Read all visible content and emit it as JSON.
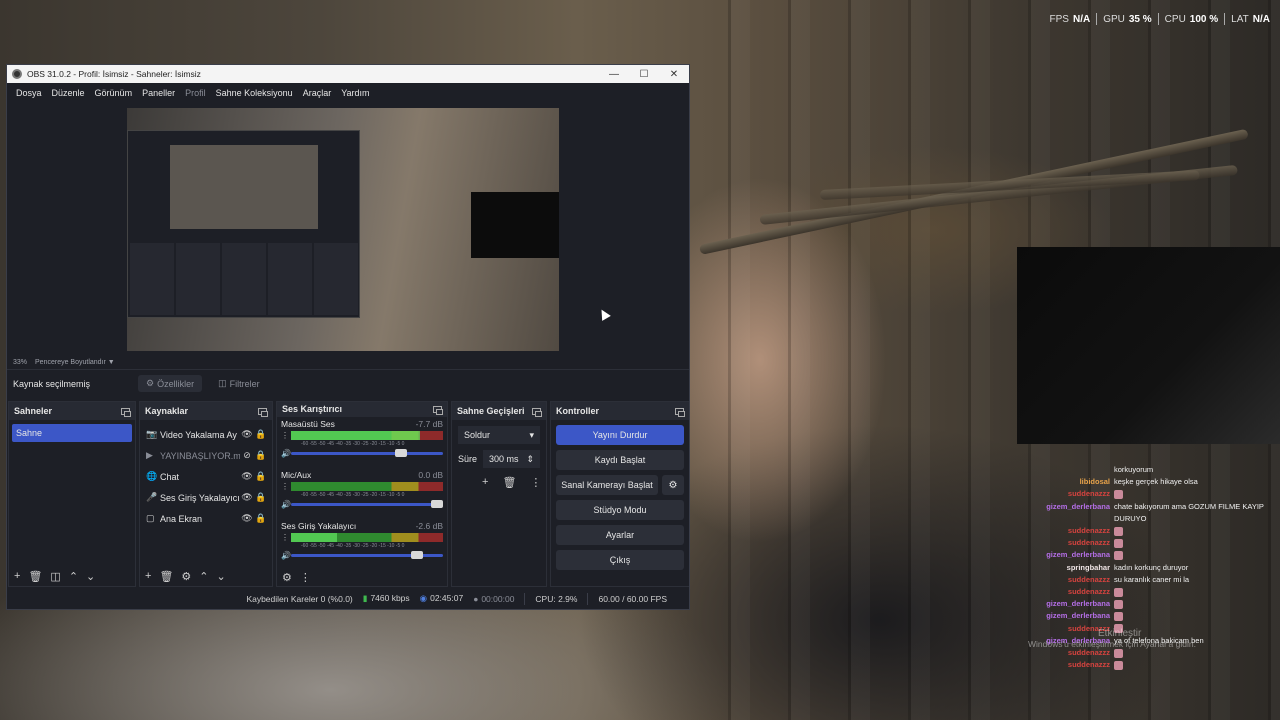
{
  "overlay_stats": [
    {
      "key": "FPS",
      "value": "N/A"
    },
    {
      "key": "GPU",
      "value": "35 %"
    },
    {
      "key": "CPU",
      "value": "100 %"
    },
    {
      "key": "LAT",
      "value": "N/A"
    }
  ],
  "obs": {
    "title": "OBS 31.0.2 - Profil: İsimsiz - Sahneler: İsimsiz",
    "menu": [
      "Dosya",
      "Düzenle",
      "Görünüm",
      "Paneller",
      "Profil",
      "Sahne Koleksiyonu",
      "Araçlar",
      "Yardım"
    ],
    "zoom": "33%",
    "fit_label": "Pencereye Boyutlandır",
    "source_toolbar": {
      "no_source": "Kaynak seçilmemiş",
      "properties": "Özellikler",
      "filters": "Filtreler"
    },
    "docks": {
      "scenes_title": "Sahneler",
      "sources_title": "Kaynaklar",
      "mixer_title": "Ses Karıştırıcı",
      "transitions_title": "Sahne Geçişleri",
      "controls_title": "Kontroller"
    },
    "scenes": [
      "Sahne"
    ],
    "sources": [
      {
        "icon": "camera-icon",
        "label": "Video Yakalama Ay"
      },
      {
        "icon": "play-icon",
        "label": "YAYINBAŞLIYOR.m"
      },
      {
        "icon": "globe-icon",
        "label": "Chat"
      },
      {
        "icon": "microphone-icon",
        "label": "Ses Giriş Yakalayıcı"
      },
      {
        "icon": "monitor-icon",
        "label": "Ana Ekran"
      }
    ],
    "mixer": [
      {
        "name": "Masaüstü Ses",
        "db": "-7.7 dB",
        "level": 0.85,
        "fader": 0.76
      },
      {
        "name": "Mic/Aux",
        "db": "0.0 dB",
        "level": 0.0,
        "fader": 1.0
      },
      {
        "name": "Ses Giriş Yakalayıcı",
        "db": "-2.6 dB",
        "level": 0.3,
        "fader": 0.87
      }
    ],
    "meter_scale": "-60 -55 -50 -45 -40 -35 -30 -25 -20 -15 -10 -5 0",
    "transitions": {
      "type": "Soldur",
      "duration_label": "Süre",
      "duration": "300 ms"
    },
    "controls": {
      "stop_stream": "Yayını Durdur",
      "start_record": "Kaydı Başlat",
      "virtual_cam": "Sanal Kamerayı Başlat",
      "studio_mode": "Stüdyo Modu",
      "settings": "Ayarlar",
      "exit": "Çıkış"
    },
    "status": {
      "dropped": "Kaybedilen Kareler 0 (%0.0)",
      "bitrate": "7460 kbps",
      "stream_time": "02:45:07",
      "record_time": "00:00:00",
      "cpu": "CPU: 2.9%",
      "fps": "60.00 / 60.00 FPS"
    }
  },
  "chat": [
    {
      "user": "",
      "user_color": "#ffffff",
      "msg": "korkuyorum",
      "emote": false
    },
    {
      "user": "libidosal",
      "user_color": "#e8a34a",
      "msg": "keşke gerçek hikaye olsa",
      "emote": false
    },
    {
      "user": "suddenazzz",
      "user_color": "#d6433f",
      "msg": "",
      "emote": true
    },
    {
      "user": "gizem_derlerbana",
      "user_color": "#b46ee6",
      "msg": "chate bakıyorum ama GOZUM FILME KAYIP DURUYO",
      "emote": false
    },
    {
      "user": "suddenazzz",
      "user_color": "#d6433f",
      "msg": "",
      "emote": true
    },
    {
      "user": "suddenazzz",
      "user_color": "#d6433f",
      "msg": "",
      "emote": true
    },
    {
      "user": "gizem_derlerbana",
      "user_color": "#b46ee6",
      "msg": "",
      "emote": true
    },
    {
      "user": "springbahar",
      "user_color": "#f0e6e6",
      "msg": "kadın korkunç duruyor",
      "emote": false
    },
    {
      "user": "suddenazzz",
      "user_color": "#d6433f",
      "msg": "su karanlık caner mi la",
      "emote": false
    },
    {
      "user": "suddenazzz",
      "user_color": "#d6433f",
      "msg": "",
      "emote": true
    },
    {
      "user": "gizem_derlerbana",
      "user_color": "#b46ee6",
      "msg": "",
      "emote": true
    },
    {
      "user": "gizem_derlerbana",
      "user_color": "#b46ee6",
      "msg": "",
      "emote": true
    },
    {
      "user": "suddenazzz",
      "user_color": "#d6433f",
      "msg": "",
      "emote": true
    },
    {
      "user": "gizem_derlerbana",
      "user_color": "#b46ee6",
      "msg": "ya of telefona bakicam ben",
      "emote": false
    },
    {
      "user": "suddenazzz",
      "user_color": "#d6433f",
      "msg": "",
      "emote": true
    },
    {
      "user": "suddenazzz",
      "user_color": "#d6433f",
      "msg": "",
      "emote": true
    }
  ],
  "windows_activation": {
    "line1": "Etkinleştir",
    "line2": "Windows'u etkinleştirmek için Ayarlar'a gidin."
  }
}
